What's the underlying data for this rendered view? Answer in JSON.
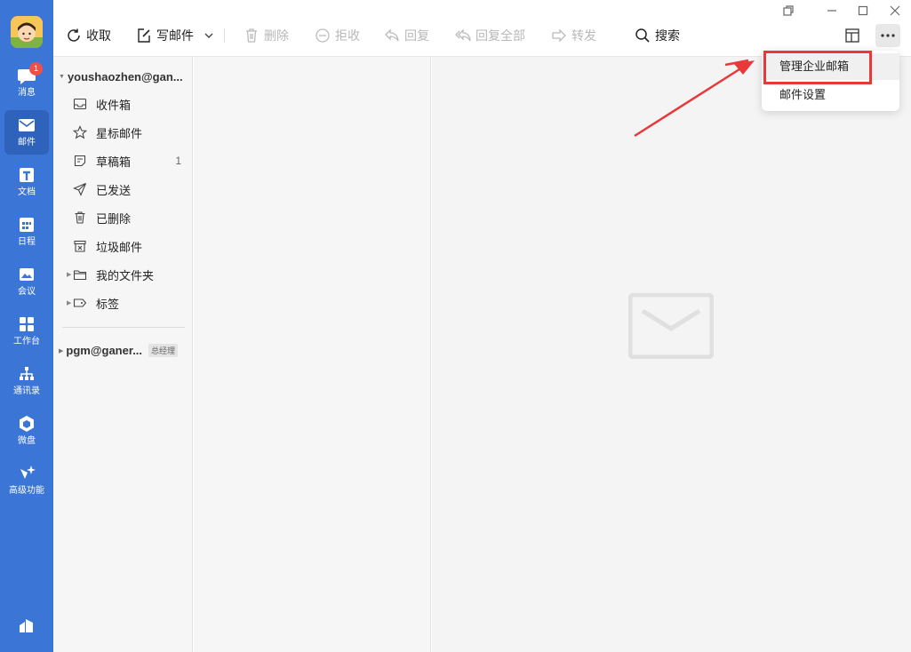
{
  "nav": {
    "items": [
      {
        "label": "消息",
        "badge": "1"
      },
      {
        "label": "邮件"
      },
      {
        "label": "文档"
      },
      {
        "label": "日程"
      },
      {
        "label": "会议"
      },
      {
        "label": "工作台"
      },
      {
        "label": "通讯录"
      },
      {
        "label": "微盘"
      },
      {
        "label": "高级功能"
      }
    ]
  },
  "toolbar": {
    "receive": "收取",
    "compose": "写邮件",
    "delete": "删除",
    "reject": "拒收",
    "reply": "回复",
    "reply_all": "回复全部",
    "forward": "转发",
    "search": "搜索"
  },
  "folders": {
    "account1": "youshaozhen@gan...",
    "items": [
      {
        "label": "收件箱",
        "count": ""
      },
      {
        "label": "星标邮件",
        "count": ""
      },
      {
        "label": "草稿箱",
        "count": "1"
      },
      {
        "label": "已发送",
        "count": ""
      },
      {
        "label": "已删除",
        "count": ""
      },
      {
        "label": "垃圾邮件",
        "count": ""
      },
      {
        "label": "我的文件夹",
        "count": ""
      },
      {
        "label": "标签",
        "count": ""
      }
    ],
    "account2": "pgm@ganer...",
    "account2_tag": "总经理"
  },
  "more_menu": {
    "items": [
      {
        "label": "管理企业邮箱"
      },
      {
        "label": "邮件设置"
      }
    ]
  },
  "colors": {
    "nav_bg": "#3b76d6",
    "highlight": "#e8383a"
  }
}
